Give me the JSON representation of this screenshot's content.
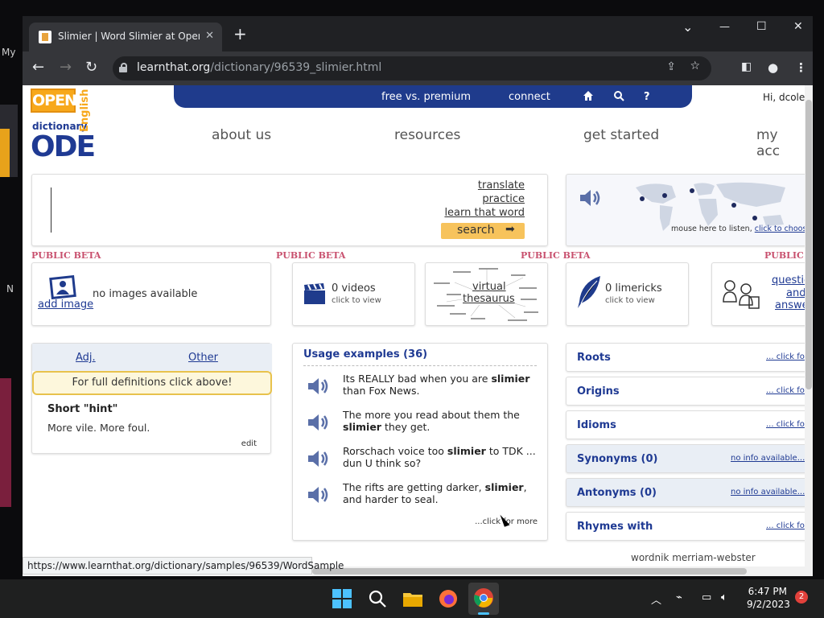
{
  "browser": {
    "tab_title": "Slimier | Word Slimier at Open Di",
    "tab_close": "✕",
    "new_tab": "+",
    "win_min": "—",
    "win_max": "☐",
    "win_close": "✕",
    "chevron": "⌄",
    "url_domain": "learnthat.org",
    "url_path": "/dictionary/96539_slimier.html",
    "status_url": "https://www.learnthat.org/dictionary/samples/96539/WordSample"
  },
  "desktop_edge": [
    "My",
    "N"
  ],
  "site": {
    "logo_open": "OPEN",
    "logo_dict": "dictionary",
    "logo_of": "of",
    "logo_ode": "ODE",
    "logo_english": "English",
    "topnav": {
      "free": "free vs. premium",
      "connect": "connect"
    },
    "greeting": "Hi, dcolew",
    "mainnav": [
      "about us",
      "resources",
      "get started",
      "my acc"
    ]
  },
  "search": {
    "links": [
      "translate",
      "practice",
      "learn that word"
    ],
    "button": "search"
  },
  "listen": {
    "text": "mouse here to listen,",
    "link": "click to choose/add"
  },
  "beta_label": "PUBLIC BETA",
  "beta_label_cut": "PUBLIC",
  "images": {
    "text": "no images available",
    "add": "add image"
  },
  "videos": {
    "count": "0 videos",
    "sub": "click to view"
  },
  "thesaurus": {
    "line1": "virtual",
    "line2": "thesaurus"
  },
  "limericks": {
    "count": "0 limericks",
    "sub": "click to view"
  },
  "qa": {
    "line1": "questio",
    "line2": "and",
    "line3": "answe"
  },
  "definitions": {
    "tab_adj": "Adj.",
    "tab_other": "Other",
    "full": "For full definitions click above!",
    "hint_title": "Short \"hint\"",
    "hint_body": "More vile. More foul.",
    "edit": "edit"
  },
  "usage": {
    "title": "Usage examples (36)",
    "examples": [
      {
        "pre": "Its REALLY bad when you are ",
        "word": "slimier",
        "post": " than Fox News."
      },
      {
        "pre": "The more you read about them the ",
        "word": "slimier",
        "post": " they get."
      },
      {
        "pre": "Rorschach voice too ",
        "word": "slimier",
        "post": " to TDK ... dun U think so?"
      },
      {
        "pre": "The rifts are getting darker, ",
        "word": "slimier",
        "post": ", and harder to seal."
      }
    ],
    "more": "...click for more"
  },
  "related": [
    {
      "title": "Roots",
      "link": "... click fo",
      "alt": false
    },
    {
      "title": "Origins",
      "link": "... click fo",
      "alt": false
    },
    {
      "title": "Idioms",
      "link": "... click fo",
      "alt": false
    },
    {
      "title": "Synonyms (0)",
      "link": "no info available...",
      "alt": true
    },
    {
      "title": "Antonyms (0)",
      "link": "no info available...",
      "alt": true
    },
    {
      "title": "Rhymes with",
      "link": "... click fo",
      "alt": false
    }
  ],
  "footer_links": "wordnik    merriam-webster",
  "taskbar": {
    "time": "6:47 PM",
    "date": "9/2/2023",
    "notifications": "2"
  },
  "colors": {
    "brand_blue": "#1f3b8c",
    "brand_orange": "#f7a81b",
    "beta_pink": "#c8506e",
    "chrome_dark": "#202124"
  },
  "icons": [
    "home-icon",
    "search-icon",
    "help-icon",
    "speaker-icon",
    "world-map",
    "person-frame-icon",
    "film-clapper-icon",
    "quill-icon",
    "people-chat-icon",
    "star-icon",
    "share-icon",
    "profile-icon",
    "menu-dots-icon"
  ]
}
